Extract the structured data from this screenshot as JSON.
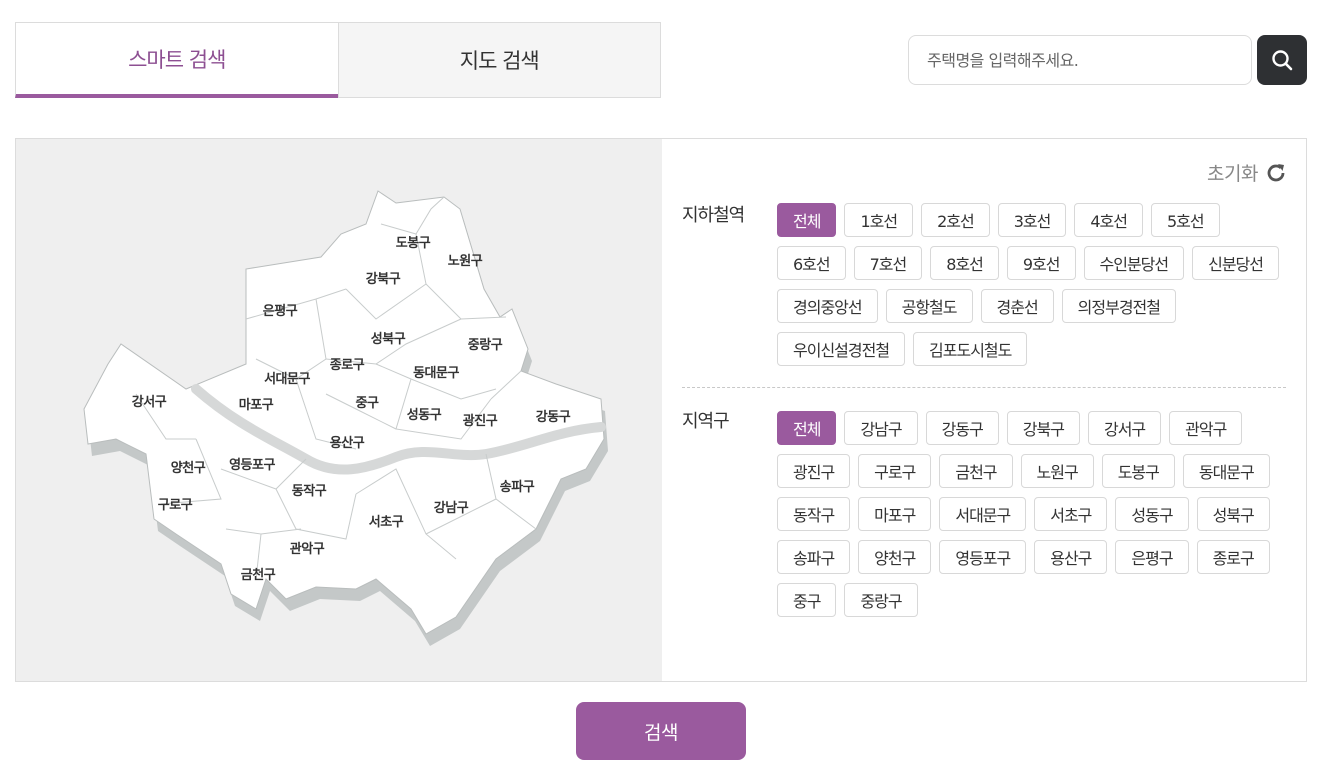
{
  "tabs": [
    {
      "label": "스마트 검색",
      "active": true
    },
    {
      "label": "지도 검색",
      "active": false
    }
  ],
  "search": {
    "placeholder": "주택명을 입력해주세요.",
    "icon": "search-icon"
  },
  "reset": {
    "label": "초기화",
    "icon": "refresh-icon"
  },
  "subway": {
    "label": "지하철역",
    "options": [
      "전체",
      "1호선",
      "2호선",
      "3호선",
      "4호선",
      "5호선",
      "6호선",
      "7호선",
      "8호선",
      "9호선",
      "수인분당선",
      "신분당선",
      "경의중앙선",
      "공항철도",
      "경춘선",
      "의정부경전철",
      "우이신설경전철",
      "김포도시철도"
    ],
    "selected": "전체"
  },
  "district": {
    "label": "지역구",
    "options": [
      "전체",
      "강남구",
      "강동구",
      "강북구",
      "강서구",
      "관악구",
      "광진구",
      "구로구",
      "금천구",
      "노원구",
      "도봉구",
      "동대문구",
      "동작구",
      "마포구",
      "서대문구",
      "서초구",
      "성동구",
      "성북구",
      "송파구",
      "양천구",
      "영등포구",
      "용산구",
      "은평구",
      "종로구",
      "중구",
      "중랑구"
    ],
    "selected": "전체"
  },
  "map": {
    "districts": [
      "도봉구",
      "노원구",
      "강북구",
      "은평구",
      "성북구",
      "중랑구",
      "종로구",
      "서대문구",
      "동대문구",
      "강서구",
      "마포구",
      "중구",
      "성동구",
      "광진구",
      "강동구",
      "용산구",
      "양천구",
      "영등포구",
      "동작구",
      "송파구",
      "구로구",
      "서초구",
      "강남구",
      "관악구",
      "금천구"
    ]
  },
  "submit": {
    "label": "검색"
  },
  "colors": {
    "accent": "#9a5a9e",
    "dark_button": "#2e3033",
    "map_bg": "#efefef"
  }
}
